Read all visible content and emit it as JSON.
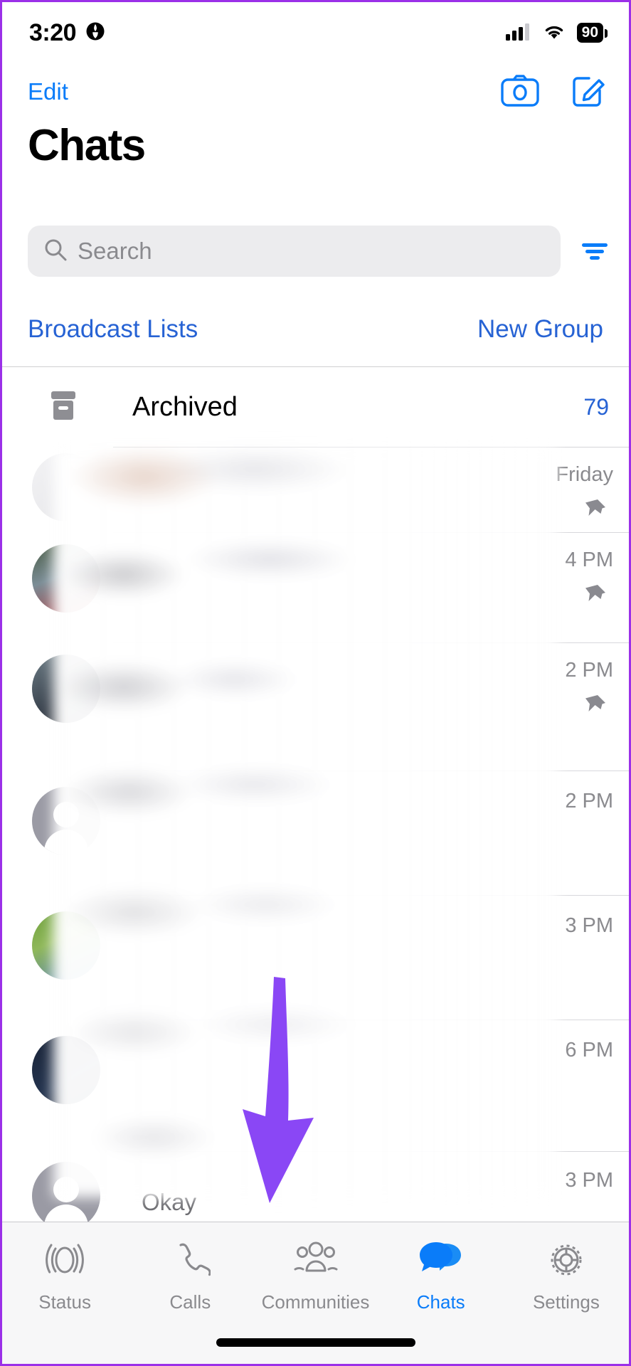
{
  "status_bar": {
    "time": "3:20",
    "location_icon": "location-arrow-icon",
    "signal_icon": "cellular-signal-icon",
    "wifi_icon": "wifi-icon",
    "battery_level": "90"
  },
  "nav_bar": {
    "edit_label": "Edit",
    "camera_icon": "camera-icon",
    "compose_icon": "compose-icon"
  },
  "page_title": "Chats",
  "search": {
    "placeholder": "Search",
    "value": "",
    "search_icon": "search-icon",
    "filter_icon": "filter-icon"
  },
  "quick_links": {
    "broadcast_lists": "Broadcast Lists",
    "new_group": "New Group"
  },
  "archived": {
    "icon": "archive-box-icon",
    "label": "Archived",
    "count": "79"
  },
  "chat_rows": [
    {
      "time": "Friday",
      "pinned": true,
      "avatar": "av-a",
      "preview": ""
    },
    {
      "time": "4 PM",
      "pinned": true,
      "avatar": "av-b",
      "preview": ""
    },
    {
      "time": "2 PM",
      "pinned": true,
      "avatar": "av-c",
      "preview": ""
    },
    {
      "time": "2 PM",
      "pinned": false,
      "avatar": "av-d",
      "preview": ""
    },
    {
      "time": "3 PM",
      "pinned": false,
      "avatar": "av-e",
      "preview": ""
    },
    {
      "time": "6 PM",
      "pinned": false,
      "avatar": "av-f",
      "preview": ""
    },
    {
      "time": "3 PM",
      "pinned": false,
      "avatar": "av-g",
      "preview": "Okay"
    }
  ],
  "annotation": {
    "arrow_color": "#8a47f5",
    "points_to": "Communities"
  },
  "tab_bar": {
    "active": "Chats",
    "items": [
      {
        "label": "Status",
        "icon": "status-rings-icon"
      },
      {
        "label": "Calls",
        "icon": "phone-icon"
      },
      {
        "label": "Communities",
        "icon": "communities-people-icon"
      },
      {
        "label": "Chats",
        "icon": "chat-bubbles-icon"
      },
      {
        "label": "Settings",
        "icon": "gear-icon"
      }
    ]
  },
  "colors": {
    "ios_blue": "#0a7cf9",
    "link_blue": "#2763d4",
    "accent_purple": "#8a47f5",
    "muted_gray": "#8a8a8e"
  }
}
